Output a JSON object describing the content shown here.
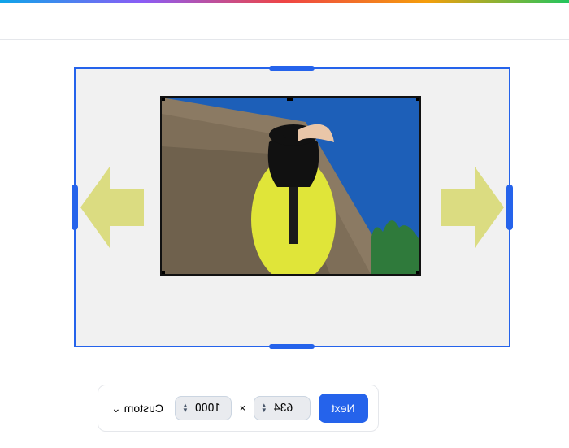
{
  "toolbar": {
    "next_label": "Next",
    "width_value": "634",
    "height_value": "1000",
    "separator": "×",
    "size_preset_label": "Custom",
    "dropdown_glyph": "⌄"
  },
  "canvas": {
    "outer_border_color": "#2563eb",
    "inner_image_alt": "photo-subject"
  }
}
